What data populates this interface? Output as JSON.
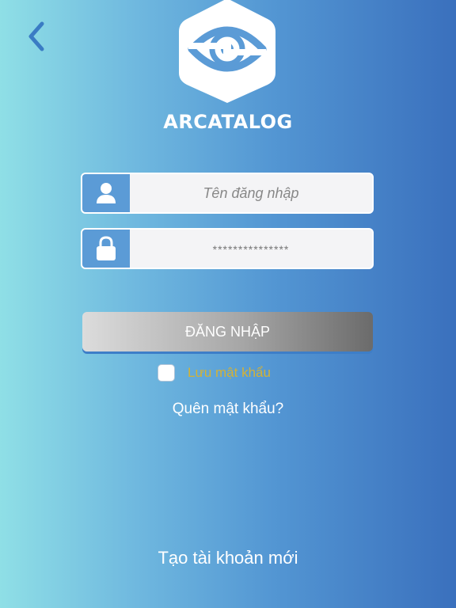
{
  "header": {
    "back_icon": "chevron-left-icon",
    "logo_icon": "arcatalog-eye-logo",
    "brand_name": "ARCATALOG"
  },
  "form": {
    "username": {
      "placeholder": "Tên đăng nhập",
      "value": "",
      "icon": "user-icon"
    },
    "password": {
      "placeholder": "***************",
      "value": "",
      "icon": "lock-icon"
    },
    "login_label": "ĐĂNG NHẬP",
    "remember_label": "Lưu mật khẩu",
    "remember_checked": false,
    "forgot_label": "Quên mật khẩu?"
  },
  "footer": {
    "create_account_label": "Tạo tài khoản mới"
  },
  "colors": {
    "accent": "#5b9bd6",
    "remember_text": "#d4b235",
    "back_chevron": "#3a7cc4"
  }
}
